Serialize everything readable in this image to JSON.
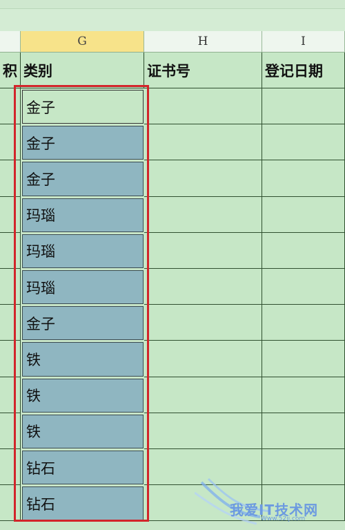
{
  "columns": [
    {
      "label": "",
      "name": "col-header-f"
    },
    {
      "label": "G",
      "name": "col-header-g",
      "active": true
    },
    {
      "label": "H",
      "name": "col-header-h"
    },
    {
      "label": "I",
      "name": "col-header-i"
    },
    {
      "label": "",
      "name": "col-header-j"
    }
  ],
  "header_row": {
    "f": "积",
    "g": "类别",
    "h": "证书号",
    "i": "登记日期"
  },
  "category_values": [
    "金子",
    "金子",
    "金子",
    "玛瑙",
    "玛瑙",
    "玛瑙",
    "金子",
    "铁",
    "铁",
    "铁",
    "钻石",
    "钻石"
  ],
  "watermark": {
    "text": "我爱IT技术网",
    "sub": "Www.52ij.com"
  },
  "colors": {
    "sheet_bg": "#c6e7c6",
    "selected_fill": "#8fb6c1",
    "selection_border": "#d2242a",
    "active_header": "#f7e38a"
  }
}
